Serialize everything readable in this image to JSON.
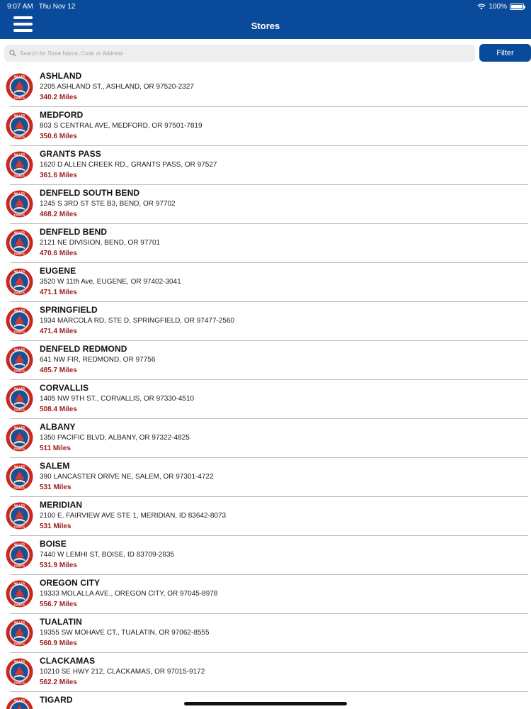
{
  "status_bar": {
    "time": "9:07 AM",
    "date": "Thu Nov 12",
    "battery": "100%"
  },
  "nav": {
    "title": "Stores",
    "menu_icon": "hamburger-menu-icon"
  },
  "search": {
    "placeholder": "Search for Store Name, Code or Address",
    "value": ""
  },
  "filter": {
    "label": "Filter"
  },
  "colors": {
    "brand": "#0a4a9a",
    "distance": "#9b1c1c",
    "logo_red": "#c8281f"
  },
  "logo": {
    "text_top": "MILLER",
    "text_bottom": "PAINTS"
  },
  "stores": [
    {
      "name": "ASHLAND",
      "address": "2205 ASHLAND ST., ASHLAND, OR  97520-2327",
      "distance": "340.2 Miles"
    },
    {
      "name": "MEDFORD",
      "address": "803 S CENTRAL AVE, MEDFORD, OR  97501-7819",
      "distance": "350.6 Miles"
    },
    {
      "name": "GRANTS PASS",
      "address": "1620 D ALLEN CREEK RD., GRANTS PASS, OR  97527",
      "distance": "361.6 Miles"
    },
    {
      "name": "DENFELD SOUTH BEND",
      "address": "1245 S 3RD ST STE B3, BEND, OR  97702",
      "distance": "468.2 Miles"
    },
    {
      "name": "DENFELD BEND",
      "address": "2121 NE DIVISION, BEND, OR  97701",
      "distance": "470.6 Miles"
    },
    {
      "name": "EUGENE",
      "address": "3520 W 11th Ave, EUGENE, OR  97402-3041",
      "distance": "471.1 Miles"
    },
    {
      "name": "SPRINGFIELD",
      "address": "1934 MARCOLA RD, STE D, SPRINGFIELD, OR  97477-2560",
      "distance": "471.4 Miles"
    },
    {
      "name": "DENFELD REDMOND",
      "address": "641 NW FIR, REDMOND, OR  97756",
      "distance": "485.7 Miles"
    },
    {
      "name": "CORVALLIS",
      "address": "1405 NW 9TH ST., CORVALLIS, OR  97330-4510",
      "distance": "508.4 Miles"
    },
    {
      "name": "ALBANY",
      "address": "1350 PACIFIC BLVD, ALBANY, OR  97322-4825",
      "distance": "511 Miles"
    },
    {
      "name": "SALEM",
      "address": "390 LANCASTER DRIVE NE, SALEM, OR  97301-4722",
      "distance": "531 Miles"
    },
    {
      "name": "MERIDIAN",
      "address": "2100 E. FAIRVIEW AVE STE 1, MERIDIAN, ID  83642-8073",
      "distance": "531 Miles"
    },
    {
      "name": "BOISE",
      "address": "7440 W LEMHI ST, BOISE, ID  83709-2835",
      "distance": "531.9 Miles"
    },
    {
      "name": "OREGON CITY",
      "address": "19333 MOLALLA AVE., OREGON CITY, OR  97045-8978",
      "distance": "556.7 Miles"
    },
    {
      "name": "TUALATIN",
      "address": "19355 SW MOHAVE CT., TUALATIN, OR  97062-8555",
      "distance": "560.9 Miles"
    },
    {
      "name": "CLACKAMAS",
      "address": "10210 SE HWY 212, CLACKAMAS, OR  97015-9172",
      "distance": "562.2 Miles"
    },
    {
      "name": "TIGARD",
      "address": "",
      "distance": ""
    }
  ]
}
